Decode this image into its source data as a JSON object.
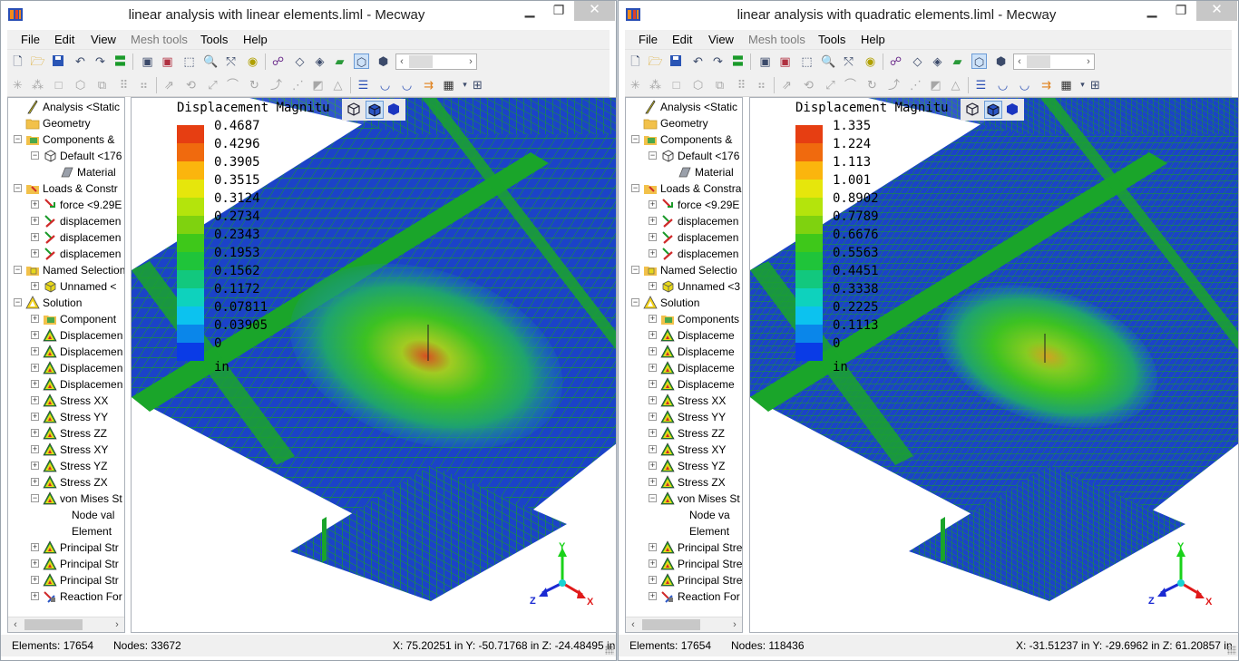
{
  "windows": [
    {
      "title": "linear analysis with linear elements.liml - Mecway",
      "menu": [
        "File",
        "Edit",
        "View",
        "Mesh tools",
        "Tools",
        "Help"
      ],
      "legend": {
        "title": "Displacement Magnitu",
        "values": [
          "0.4687",
          "0.4296",
          "0.3905",
          "0.3515",
          "0.3124",
          "0.2734",
          "0.2343",
          "0.1953",
          "0.1562",
          "0.1172",
          "0.07811",
          "0.03905",
          "0",
          "in"
        ]
      },
      "status": {
        "elements": "Elements:  17654",
        "nodes": "Nodes: 33672",
        "coords": "X: 75.20251 in Y: -50.71768 in Z: -24.48495 in"
      }
    },
    {
      "title": "linear analysis with quadratic elements.liml - Mecway",
      "menu": [
        "File",
        "Edit",
        "View",
        "Mesh tools",
        "Tools",
        "Help"
      ],
      "legend": {
        "title": "Displacement Magnitu",
        "values": [
          "1.335",
          "1.224",
          "1.113",
          "1.001",
          "0.8902",
          "0.7789",
          "0.6676",
          "0.5563",
          "0.4451",
          "0.3338",
          "0.2225",
          "0.1113",
          "0",
          "in"
        ]
      },
      "status": {
        "elements": "Elements:  17654",
        "nodes": "Nodes: 118436",
        "coords": "X: -31.51237 in Y: -29.6962 in Z: 61.20857 in"
      }
    }
  ],
  "trees": [
    [
      "Analysis <Static",
      "Geometry",
      "Components &",
      "Default <176",
      "Material",
      "Loads & Constr",
      "force <9.29E",
      "displacemen",
      "displacemen",
      "displacemen",
      "Named Selection",
      "Unnamed <",
      "Solution",
      "Component",
      "Displacemen",
      "Displacemen",
      "Displacemen",
      "Displacemen",
      "Stress XX",
      "Stress YY",
      "Stress ZZ",
      "Stress XY",
      "Stress YZ",
      "Stress ZX",
      "von Mises St",
      "Node val",
      "Element",
      "Principal Str",
      "Principal Str",
      "Principal Str",
      "Reaction For"
    ],
    [
      "Analysis <Static",
      "Geometry",
      "Components &",
      "Default <176",
      "Material",
      "Loads & Constra",
      "force <9.29E",
      "displacemen",
      "displacemen",
      "displacemen",
      "Named Selectio",
      "Unnamed <3",
      "Solution",
      "Components",
      "Displaceme",
      "Displaceme",
      "Displaceme",
      "Displaceme",
      "Stress XX",
      "Stress YY",
      "Stress ZZ",
      "Stress XY",
      "Stress YZ",
      "Stress ZX",
      "von Mises St",
      "Node va",
      "Element ",
      "Principal Stre",
      "Principal Stre",
      "Principal Stre",
      "Reaction For"
    ]
  ],
  "legend_colors": [
    "#e63e12",
    "#f06a0e",
    "#fbb50d",
    "#e6e60c",
    "#b4e40c",
    "#7fd20f",
    "#3ec81a",
    "#1fc43a",
    "#12c87e",
    "#0ed2bd",
    "#0cc2ef",
    "#0a86ea",
    "#0a3be6"
  ],
  "axis_labels": {
    "x": "X",
    "y": "Y",
    "z": "Z"
  },
  "icons": [
    "app-icon",
    "new-icon",
    "open-icon",
    "save-icon",
    "undo-icon",
    "redo-icon",
    "solve-icon",
    "view-cube-icon",
    "select-icon",
    "zoom-icon",
    "table-icon"
  ]
}
